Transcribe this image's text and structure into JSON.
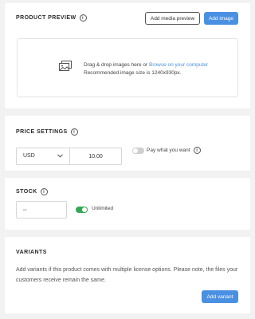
{
  "product_preview": {
    "title": "PRODUCT PREVIEW",
    "add_media_preview_label": "Add media preview",
    "add_image_label": "Add image",
    "dropzone": {
      "text_before_link": "Drag & drop images here or ",
      "link_text": "Browse on your computer",
      "size_note": "Recommended image size is 1240x930px."
    }
  },
  "price_settings": {
    "title": "PRICE SETTINGS",
    "currency": "USD",
    "price": "10.00",
    "pay_what_you_want_label": "Pay what you want",
    "pay_what_you_want_enabled": false
  },
  "stock": {
    "title": "STOCK",
    "placeholder": "∞",
    "unlimited_label": "Unlimited",
    "unlimited_enabled": true
  },
  "variants": {
    "title": "VARIANTS",
    "description": "Add variants if this product comes with multiple license options. Please note, the files your customers receive remain the same.",
    "add_variant_label": "Add variant"
  },
  "colors": {
    "page_background": "#f2f2f3",
    "primary": "#4a90e2",
    "toggle_on": "#34a853",
    "toggle_off": "#cfcfcf"
  }
}
